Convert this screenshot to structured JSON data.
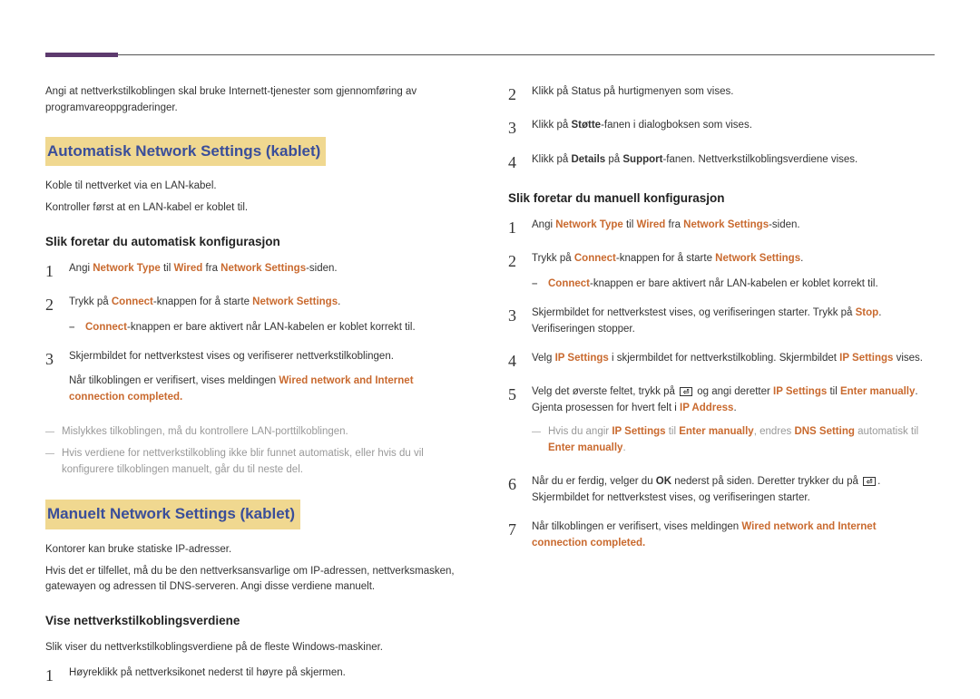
{
  "left": {
    "intro": "Angi at nettverkstilkoblingen skal bruke Internett-tjenester som gjennomføring av programvareoppgraderinger.",
    "section1": {
      "title": "Automatisk Network Settings  (kablet)",
      "p1": "Koble til nettverket via en LAN-kabel.",
      "p2": "Kontroller først at en LAN-kabel er koblet til.",
      "sub": "Slik foretar du automatisk konfigurasjon",
      "steps": {
        "s1_a": "Angi ",
        "s1_h1": "Network Type",
        "s1_b": " til ",
        "s1_h2": "Wired",
        "s1_c": " fra ",
        "s1_h3": "Network Settings",
        "s1_d": "-siden.",
        "s2_a": "Trykk på ",
        "s2_h1": "Connect",
        "s2_b": "-knappen for å starte ",
        "s2_h2": "Network Settings",
        "s2_c": ".",
        "s2_sub_h": "Connect",
        "s2_sub_t": "-knappen er bare aktivert når LAN-kabelen er koblet korrekt til.",
        "s3_a": "Skjermbildet for nettverkstest vises og verifiserer nettverkstilkoblingen.",
        "s3_b": "Når tilkoblingen er verifisert, vises meldingen ",
        "s3_h": "Wired network and Internet connection completed.",
        "note1": "Mislykkes tilkoblingen, må du kontrollere LAN-porttilkoblingen.",
        "note2": "Hvis verdiene for nettverkstilkobling ikke blir funnet automatisk, eller hvis du vil konfigurere tilkoblingen manuelt, går du til neste del."
      }
    },
    "section2": {
      "title": "Manuelt Network Settings (kablet)",
      "p1": "Kontorer kan bruke statiske IP-adresser.",
      "p2": "Hvis det er tilfellet, må du be den nettverksansvarlige om IP-adressen, nettverksmasken, gatewayen og adressen til DNS-serveren. Angi disse verdiene manuelt.",
      "sub": "Vise nettverkstilkoblingsverdiene",
      "p3": "Slik viser du nettverkstilkoblingsverdiene på de fleste Windows-maskiner.",
      "s1": "Høyreklikk på nettverksikonet nederst til høyre på skjermen."
    }
  },
  "right": {
    "topsteps": {
      "s2": "Klikk på Status på hurtigmenyen som vises.",
      "s3a": "Klikk på ",
      "s3b": "Støtte",
      "s3c": "-fanen i dialogboksen som vises.",
      "s4a": "Klikk på ",
      "s4b": "Details",
      "s4c": " på ",
      "s4d": "Support",
      "s4e": "-fanen. Nettverkstilkoblingsverdiene vises."
    },
    "sub": "Slik foretar du manuell konfigurasjon",
    "steps": {
      "s1_a": "Angi ",
      "s1_h1": "Network Type",
      "s1_b": " til ",
      "s1_h2": "Wired",
      "s1_c": " fra ",
      "s1_h3": "Network Settings",
      "s1_d": "-siden.",
      "s2_a": "Trykk på ",
      "s2_h1": "Connect",
      "s2_b": "-knappen for å starte ",
      "s2_h2": "Network Settings",
      "s2_c": ".",
      "s2_sub_h": "Connect",
      "s2_sub_t": "-knappen er bare aktivert når LAN-kabelen er koblet korrekt til.",
      "s3_a": "Skjermbildet for nettverkstest vises, og verifiseringen starter. Trykk på ",
      "s3_h": "Stop",
      "s3_b": ". Verifiseringen stopper.",
      "s4_a": "Velg ",
      "s4_h1": "IP Settings",
      "s4_b": " i skjermbildet for nettverkstilkobling. Skjermbildet ",
      "s4_h2": "IP Settings",
      "s4_c": " vises.",
      "s5_a": "Velg det øverste feltet, trykk på ",
      "s5_b": " og angi deretter ",
      "s5_h1": "IP Settings",
      "s5_c": " til ",
      "s5_h2": "Enter manually",
      "s5_d": ". Gjenta prosessen for hvert felt i ",
      "s5_h3": "IP Address",
      "s5_e": ".",
      "s5_note_a": "Hvis du angir ",
      "s5_note_h1": "IP Settings",
      "s5_note_b": " til ",
      "s5_note_h2": "Enter manually",
      "s5_note_c": ", endres ",
      "s5_note_h3": "DNS Setting",
      "s5_note_d": " automatisk til ",
      "s5_note_h4": "Enter manually",
      "s5_note_e": ".",
      "s6_a": "Når du er ferdig, velger du ",
      "s6_b1": "OK",
      "s6_b": " nederst på siden. Deretter trykker du på ",
      "s6_c": ". Skjermbildet for nettverkstest vises, og verifiseringen starter.",
      "s7_a": "Når tilkoblingen er verifisert, vises meldingen ",
      "s7_h": "Wired network and Internet connection completed."
    }
  }
}
